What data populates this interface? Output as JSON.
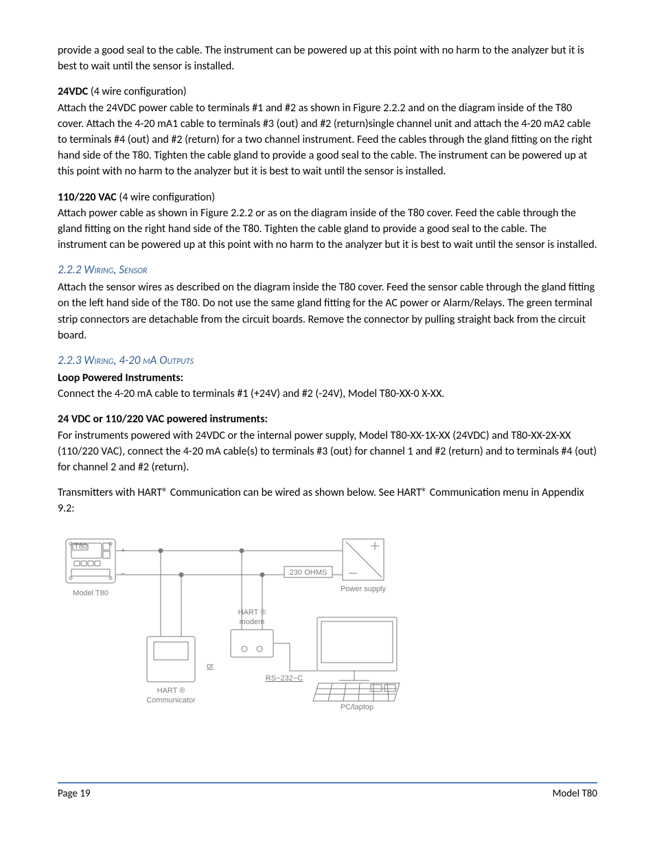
{
  "paragraphs": {
    "intro": "provide a good seal to the cable. The instrument can be powered up at this point with no harm to the analyzer but it is best to wait until the sensor is installed.",
    "p24vdc_label": "24VDC",
    "p24vdc_suffix": " (4 wire configuration)",
    "p24vdc_body": "Attach the 24VDC power cable to terminals #1 and #2 as shown in Figure 2.2.2 and on the diagram inside of the T80 cover. Attach the 4-20 mA1 cable to terminals #3 (out) and #2 (return)single channel unit and attach the 4-20 mA2 cable to terminals #4 (out) and #2 (return) for a two channel instrument. Feed the cables through the gland fitting on the right hand side of the T80. Tighten the cable gland to provide a good seal to the cable. The instrument can be powered up at this point with no harm to the analyzer but it is best to wait until the sensor is installed.",
    "p110_label": "110/220 VAC",
    "p110_suffix": " (4 wire configuration)",
    "p110_body": "Attach power cable as shown in Figure 2.2.2 or as on the diagram inside of the T80 cover. Feed the cable through the gland fitting on the right hand side of the T80. Tighten the cable gland to provide a good seal to the cable. The instrument can be powered up at this point with no harm to the analyzer but it is best to wait until the sensor is installed.",
    "h222": "2.2.2 Wiring, Sensor",
    "p222": "Attach the sensor wires as described on the diagram inside the T80 cover. Feed the sensor cable through the gland fitting on the left hand side of the T80. Do not use the same gland fitting for the AC power or Alarm/Relays. The green terminal strip connectors are detachable from the circuit boards. Remove the connector by pulling straight back from the circuit board.",
    "h223": "2.2.3 Wiring, 4-20 mA Outputs",
    "loop_label": "Loop Powered Instruments:",
    "loop_body": "Connect the 4-20 mA cable to terminals #1 (+24V) and #2 (-24V), Model T80-XX-0 X-XX.",
    "ac_label": "24 VDC or 110/220 VAC powered instruments:",
    "ac_body": "For instruments powered with 24VDC or the internal power supply, Model T80-XX-1X-XX (24VDC) and T80-XX-2X-XX (110/220 VAC), connect the 4-20 mA cable(s) to terminals #3 (out) for channel 1 and #2 (return) and to terminals #4 (out) for channel 2 and #2 (return).",
    "hart": "Transmitters with HART® Communication can be wired as shown below. See HART® Communication menu in Appendix 9.2:"
  },
  "diagram": {
    "model_t80": "Model T80",
    "t80_badge": "T80",
    "plus": "+",
    "minus": "−",
    "ohms": "230 OHMS",
    "power_supply": "Power supply",
    "hart_modem_l1": "HART ®",
    "hart_modem_l2": "modem",
    "or": "or",
    "rs232": "RS−232−C",
    "hart_comm_l1": "HART ®",
    "hart_comm_l2": "Communicator",
    "pc": "PC/laptop"
  },
  "footer": {
    "page": "Page 19",
    "model": "Model T80"
  }
}
